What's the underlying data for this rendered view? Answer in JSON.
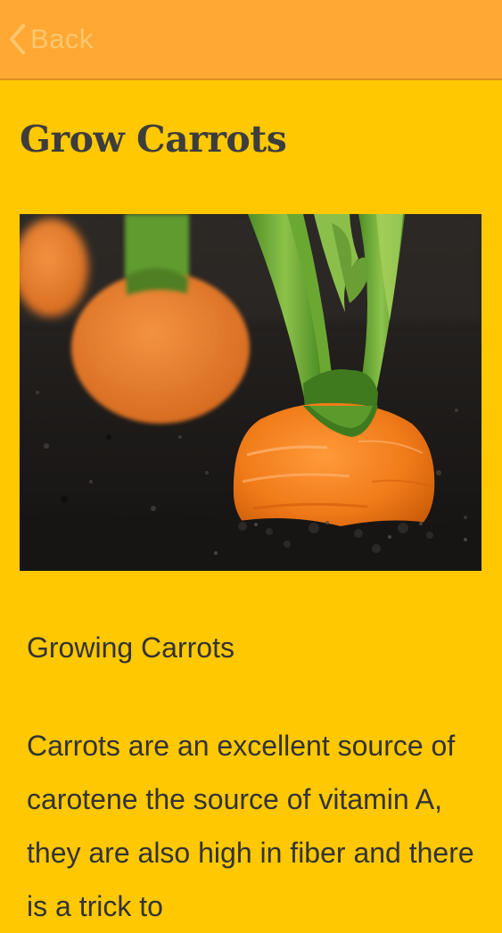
{
  "nav": {
    "back_label": "Back",
    "back_icon": "chevron-left-icon"
  },
  "page": {
    "title": "Grow Carrots"
  },
  "article": {
    "heading": "Growing Carrots",
    "body": "Carrots are an excellent source of carotene the source of vitamin A, they are also high in fiber and there is a trick to"
  },
  "colors": {
    "background": "#FFC800",
    "header": "#FFA833",
    "back_text": "#FFC76E",
    "text": "#333333"
  }
}
